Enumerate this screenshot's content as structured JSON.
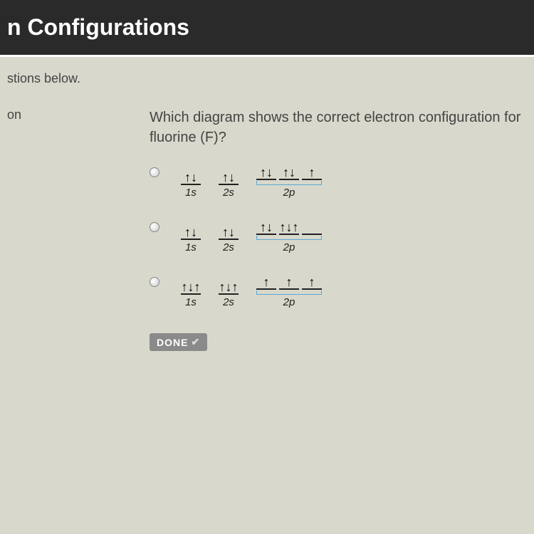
{
  "header": {
    "title_fragment": "n Configurations"
  },
  "instructions_fragment": "stions below.",
  "left_fragment": "on",
  "question": {
    "text": "Which diagram shows the correct electron configuration for fluorine (F)?"
  },
  "options": [
    {
      "id": "opt1",
      "orbitals": [
        {
          "label": "1s",
          "boxes": [
            "↑↓"
          ]
        },
        {
          "label": "2s",
          "boxes": [
            "↑↓"
          ]
        },
        {
          "label": "2p",
          "boxes": [
            "↑↓",
            "↑↓",
            "↑"
          ]
        }
      ]
    },
    {
      "id": "opt2",
      "orbitals": [
        {
          "label": "1s",
          "boxes": [
            "↑↓"
          ]
        },
        {
          "label": "2s",
          "boxes": [
            "↑↓"
          ]
        },
        {
          "label": "2p",
          "boxes": [
            "↑↓",
            "↑↓↑",
            ""
          ]
        }
      ]
    },
    {
      "id": "opt3",
      "orbitals": [
        {
          "label": "1s",
          "boxes": [
            "↑↓↑"
          ]
        },
        {
          "label": "2s",
          "boxes": [
            "↑↓↑"
          ]
        },
        {
          "label": "2p",
          "boxes": [
            "↑",
            "↑",
            "↑"
          ]
        }
      ]
    }
  ],
  "done_label": "DONE"
}
